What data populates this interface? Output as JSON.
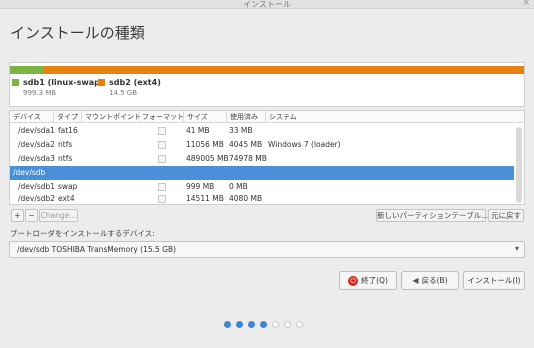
{
  "window": {
    "title": "インストール",
    "close_glyph": "×"
  },
  "page": {
    "heading": "インストールの種類"
  },
  "partition_bar": {
    "segments": [
      {
        "name": "sdb1-swap",
        "color": "#7cb342",
        "fraction": 0.065
      },
      {
        "name": "sdb2-ext4",
        "color": "#e8810f",
        "fraction": 0.935
      }
    ],
    "legend": [
      {
        "name": "sdb1 (linux-swap)",
        "size": "999.3 MB",
        "color": "#7cb342"
      },
      {
        "name": "sdb2 (ext4)",
        "size": "14.5 GB",
        "color": "#e8810f"
      }
    ]
  },
  "table": {
    "columns": [
      "デバイス",
      "タイプ",
      "マウントポイント",
      "フォーマット",
      "サイズ",
      "使用済み",
      "システム"
    ],
    "rows": [
      {
        "device": "/dev/sda1",
        "type": "fat16",
        "mount": "",
        "format": false,
        "size": "41 MB",
        "used": "33 MB",
        "system": ""
      },
      {
        "device": "/dev/sda2",
        "type": "ntfs",
        "mount": "",
        "format": false,
        "size": "11056 MB",
        "used": "4045 MB",
        "system": "Windows 7 (loader)"
      },
      {
        "device": "/dev/sda3",
        "type": "ntfs",
        "mount": "",
        "format": false,
        "size": "489005 MB",
        "used": "74978 MB",
        "system": ""
      },
      {
        "device": "/dev/sdb",
        "selected": true
      },
      {
        "device": "/dev/sdb1",
        "type": "swap",
        "mount": "",
        "format": false,
        "size": "999 MB",
        "used": "0 MB",
        "system": ""
      },
      {
        "device": "/dev/sdb2",
        "type": "ext4",
        "mount": "",
        "format": false,
        "size": "14511 MB",
        "used": "4080 MB",
        "system": ""
      }
    ]
  },
  "toolbar": {
    "add_label": "+",
    "remove_label": "−",
    "change_label": "Change...",
    "new_table_label": "新しいパーティションテーブル...",
    "revert_label": "元に戻す"
  },
  "bootloader": {
    "label": "ブートローダをインストールするデバイス:",
    "value": "/dev/sdb    TOSHIBA TransMemory (15.5 GB)",
    "arrow": "▾"
  },
  "buttons": {
    "quit_label": "終了(Q)",
    "back_label": "戻る(B)",
    "install_label": "インストール(I)",
    "quit_icon": "⏻",
    "back_icon": "◀"
  },
  "progress": {
    "total_steps": 7,
    "current_step": 4
  }
}
